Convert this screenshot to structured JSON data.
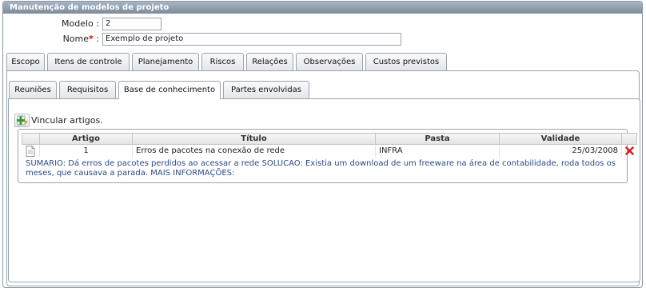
{
  "window": {
    "title": "Manutenção de modelos de projeto"
  },
  "form": {
    "modelo_label": "Modelo :",
    "modelo_value": "2",
    "nome_label": "Nome",
    "nome_required": "*",
    "nome_colon": " :",
    "nome_value": "Exemplo de projeto"
  },
  "main_tabs": [
    {
      "label": "Escopo",
      "active": false
    },
    {
      "label": "Itens de controle",
      "active": false
    },
    {
      "label": "Planejamento",
      "active": false
    },
    {
      "label": "Riscos",
      "active": false
    },
    {
      "label": "Relações",
      "active": true
    },
    {
      "label": "Observações",
      "active": false
    },
    {
      "label": "Custos previstos",
      "active": false
    }
  ],
  "sub_tabs": [
    {
      "label": "Reuniões",
      "active": false
    },
    {
      "label": "Requisitos",
      "active": false
    },
    {
      "label": "Base de conhecimento",
      "active": true
    },
    {
      "label": "Partes envolvidas",
      "active": false
    }
  ],
  "toolbar": {
    "add_icon": "add-article-icon",
    "link_label": "Vincular artigos."
  },
  "table": {
    "columns": [
      "",
      "Artigo",
      "Título",
      "Pasta",
      "Validade",
      ""
    ],
    "rows": [
      {
        "icon": "document-icon",
        "artigo": "1",
        "titulo": "Erros de pacotes na conexão de rede",
        "pasta": "INFRA",
        "validade": "25/03/2008",
        "delete_icon": "delete-icon"
      }
    ],
    "summary": "SUMARIO: Dá erros de pacotes perdidos ao acessar a rede SOLUCAO: Existia um download de um freeware na área de contabilidade, roda todos os meses, que causava a parada. MAIS INFORMAÇÕES:"
  },
  "colors": {
    "titlebar": "#8e9bab",
    "summary_text": "#2b4a86",
    "add_icon_green": "#3a9a2a",
    "delete_red": "#d62020"
  }
}
